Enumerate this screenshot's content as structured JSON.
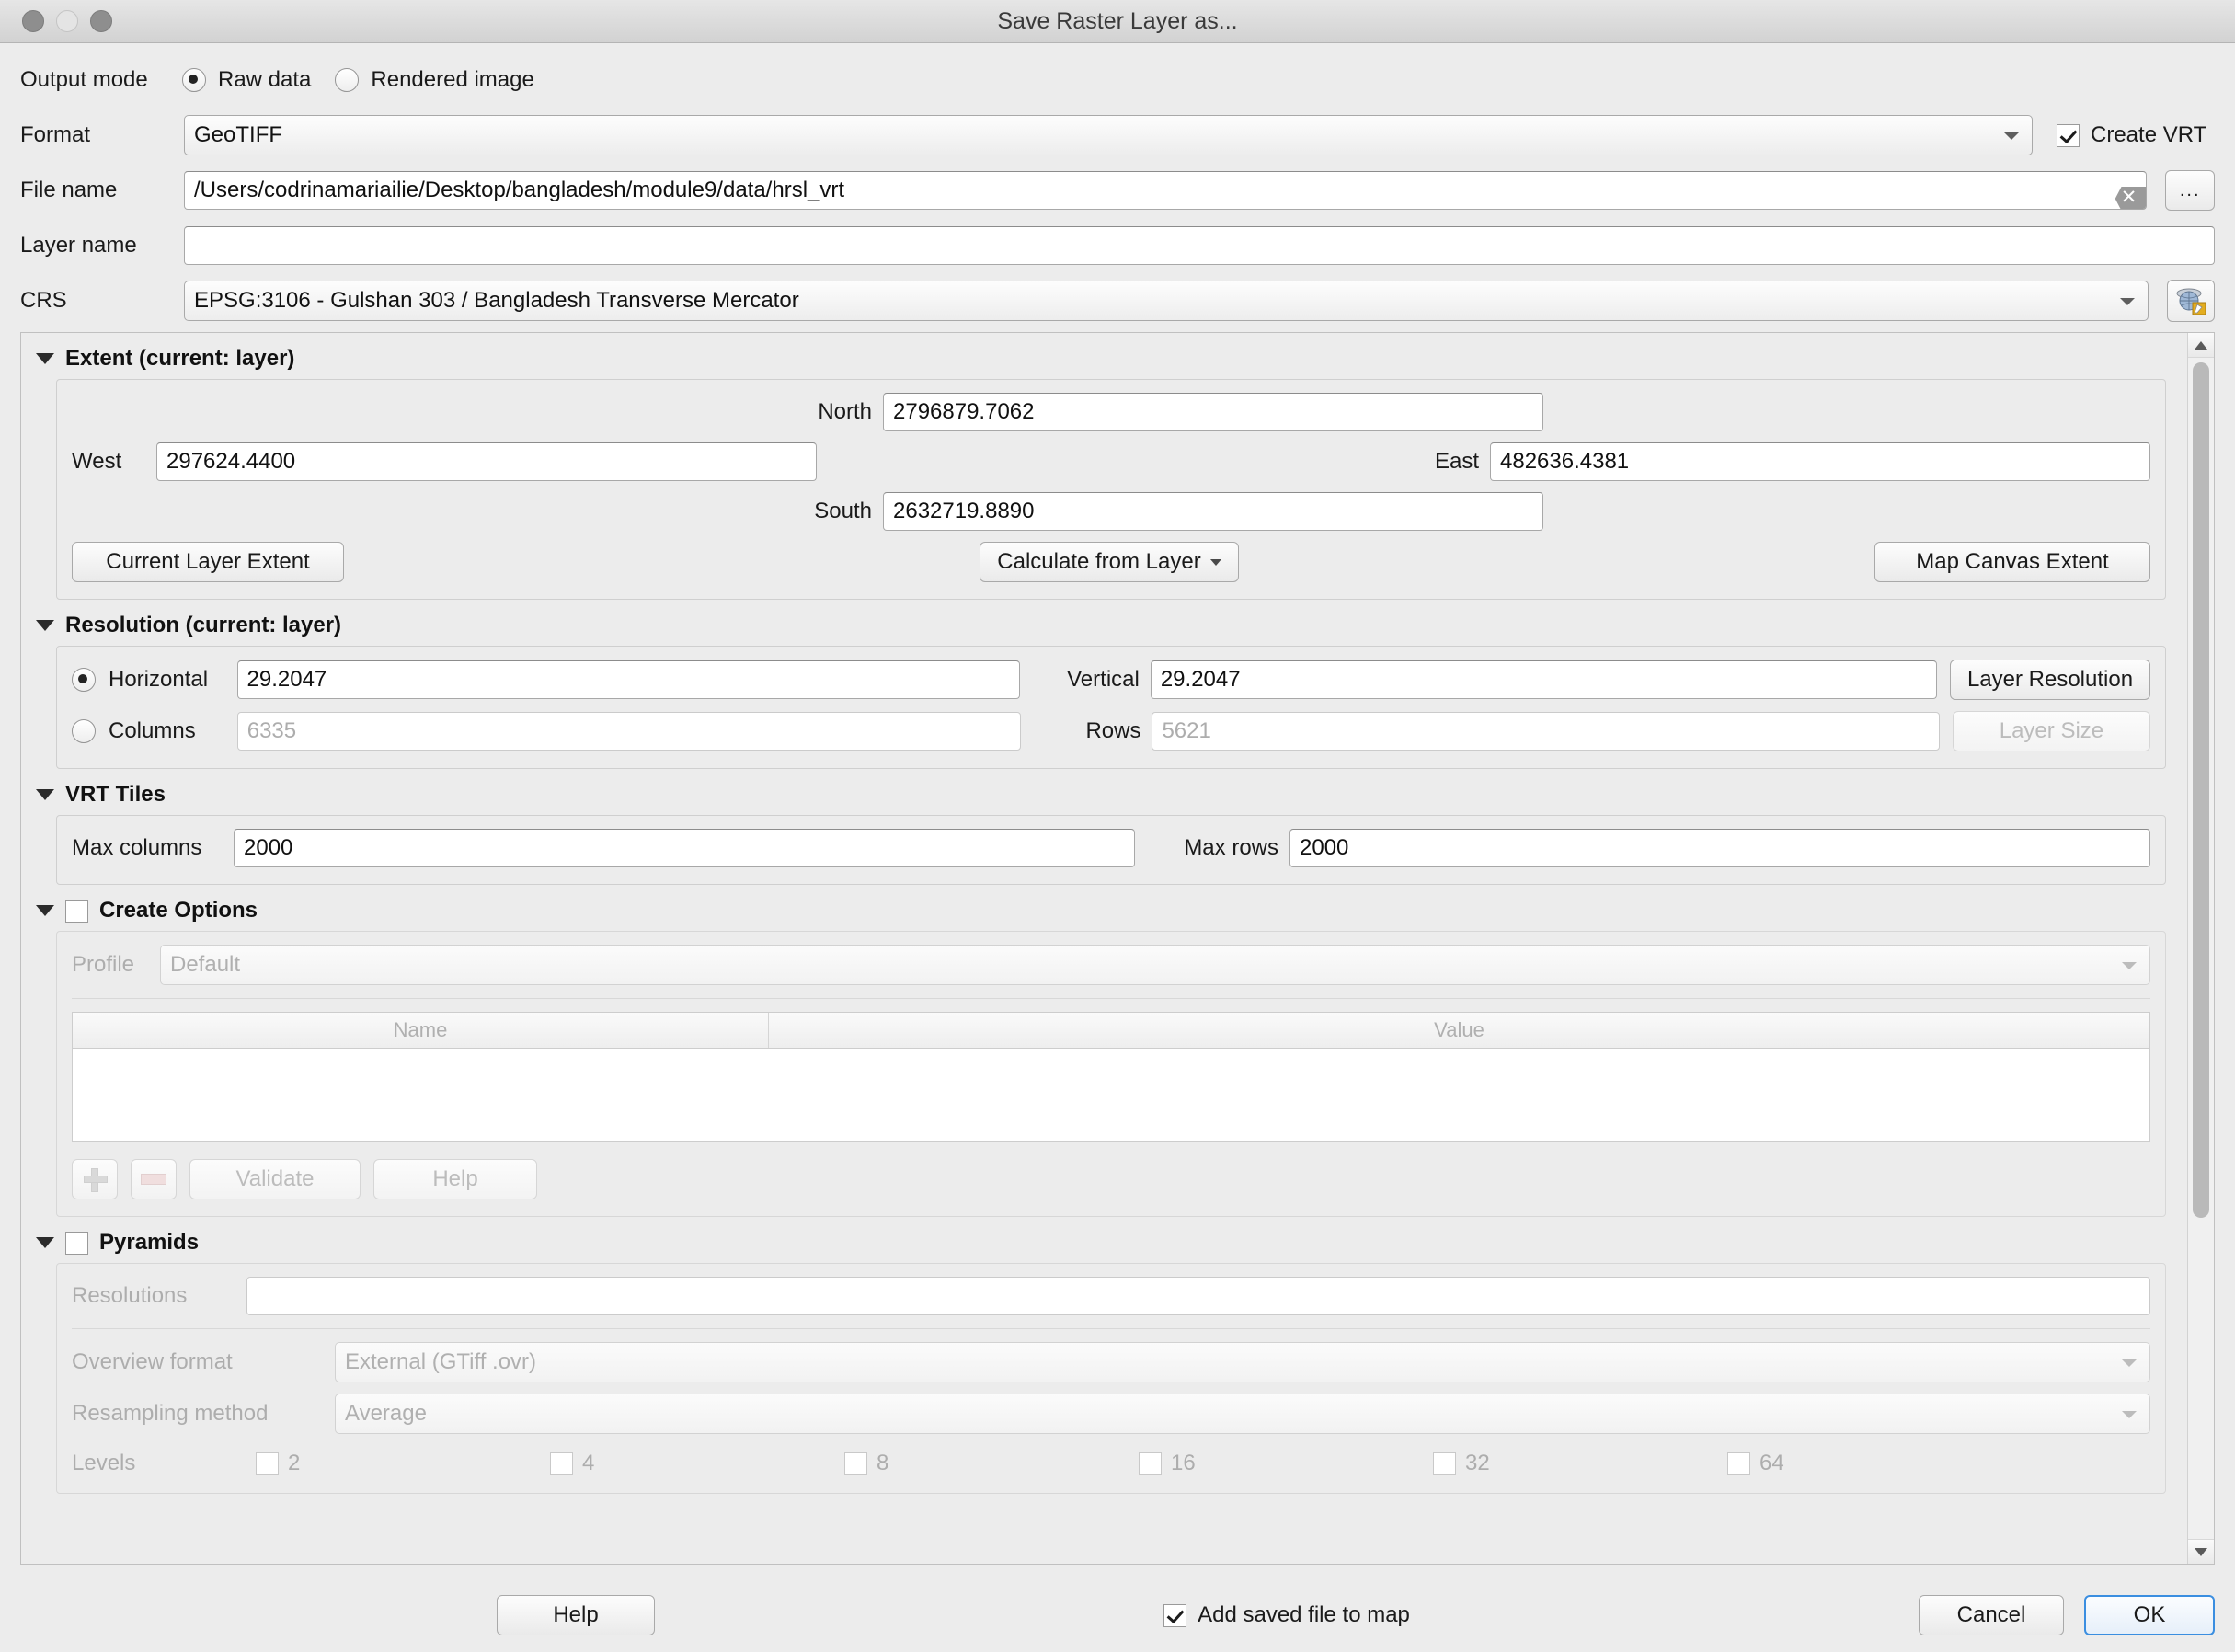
{
  "window": {
    "title": "Save Raster Layer as...",
    "traffic_lights": [
      "close",
      "minimize",
      "zoom"
    ]
  },
  "output_mode": {
    "label": "Output mode",
    "options": [
      {
        "label": "Raw data",
        "selected": true
      },
      {
        "label": "Rendered image",
        "selected": false
      }
    ]
  },
  "format": {
    "label": "Format",
    "value": "GeoTIFF",
    "create_vrt": {
      "label": "Create VRT",
      "checked": true
    }
  },
  "file_name": {
    "label": "File name",
    "value": "/Users/codrinamariailie/Desktop/bangladesh/module9/data/hrsl_vrt",
    "clear_icon": "clear-icon",
    "browse_label": "..."
  },
  "layer_name": {
    "label": "Layer name",
    "value": ""
  },
  "crs": {
    "label": "CRS",
    "value": "EPSG:3106 - Gulshan 303 / Bangladesh Transverse Mercator",
    "select_icon": "crs-globe-icon"
  },
  "extent": {
    "title": "Extent (current: layer)",
    "north_label": "North",
    "north_value": "2796879.7062",
    "west_label": "West",
    "west_value": "297624.4400",
    "east_label": "East",
    "east_value": "482636.4381",
    "south_label": "South",
    "south_value": "2632719.8890",
    "current_layer_extent": "Current Layer Extent",
    "calculate_from_layer": "Calculate from Layer",
    "map_canvas_extent": "Map Canvas Extent"
  },
  "resolution": {
    "title": "Resolution (current: layer)",
    "horizontal_label": "Horizontal",
    "horizontal_value": "29.2047",
    "horizontal_selected": true,
    "vertical_label": "Vertical",
    "vertical_value": "29.2047",
    "layer_resolution_label": "Layer Resolution",
    "columns_label": "Columns",
    "columns_value": "6335",
    "columns_selected": false,
    "rows_label": "Rows",
    "rows_value": "5621",
    "layer_size_label": "Layer Size"
  },
  "vrt_tiles": {
    "title": "VRT Tiles",
    "max_columns_label": "Max columns",
    "max_columns_value": "2000",
    "max_rows_label": "Max rows",
    "max_rows_value": "2000"
  },
  "create_options": {
    "title": "Create Options",
    "checked": false,
    "profile_label": "Profile",
    "profile_value": "Default",
    "table_headers": [
      "Name",
      "Value"
    ],
    "table_rows": [],
    "add_icon": "plus-icon",
    "remove_icon": "minus-icon",
    "validate_label": "Validate",
    "help_label": "Help"
  },
  "pyramids": {
    "title": "Pyramids",
    "checked": false,
    "resolutions_label": "Resolutions",
    "resolutions_value": "",
    "overview_format_label": "Overview format",
    "overview_format_value": "External (GTiff .ovr)",
    "resampling_method_label": "Resampling method",
    "resampling_method_value": "Average",
    "levels_label": "Levels",
    "levels": [
      {
        "label": "2",
        "checked": false
      },
      {
        "label": "4",
        "checked": false
      },
      {
        "label": "8",
        "checked": false
      },
      {
        "label": "16",
        "checked": false
      },
      {
        "label": "32",
        "checked": false
      },
      {
        "label": "64",
        "checked": false
      }
    ]
  },
  "footer": {
    "help_label": "Help",
    "add_saved_file_label": "Add saved file to map",
    "add_saved_file_checked": true,
    "cancel_label": "Cancel",
    "ok_label": "OK"
  },
  "colors": {
    "window_bg": "#ececec",
    "field_bg": "#ffffff",
    "accent": "#3b8ee0",
    "disabled_text": "#b0b0b0"
  }
}
